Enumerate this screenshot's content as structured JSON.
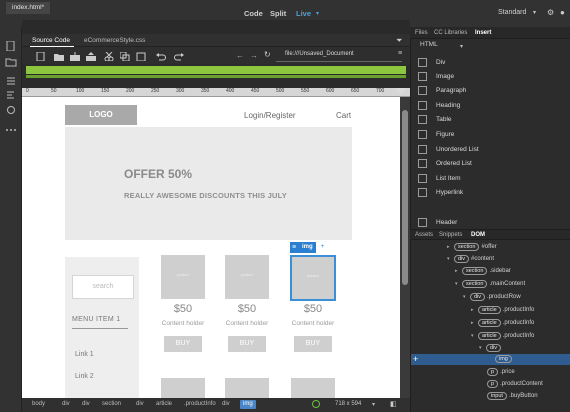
{
  "topbar": {
    "views": [
      "Code",
      "Split",
      "Live"
    ],
    "active_view": "Live",
    "workspace": "Standard",
    "workspace_icons": [
      "dropdown-icon",
      "gear-icon",
      "user-icon"
    ]
  },
  "document": {
    "tab": "index.html*",
    "subtabs": [
      "Source Code",
      "eCommerceStyle.css"
    ],
    "address": "file:///Unsaved_Document"
  },
  "ruler": {
    "ticks": [
      "0",
      "50",
      "100",
      "150",
      "200",
      "250",
      "300",
      "350",
      "400",
      "450",
      "500",
      "550",
      "600",
      "650",
      "700"
    ]
  },
  "page": {
    "logo": "LOGO",
    "nav": [
      "Login/Register",
      "Cart"
    ],
    "hero_title": "OFFER 50%",
    "hero_subtitle": "REALLY AWESOME DISCOUNTS THIS JULY",
    "search_placeholder": "search",
    "menu_title": "MENU ITEM 1",
    "links": [
      "Link 1",
      "Link 2"
    ],
    "products": [
      {
        "img_label": "product",
        "price": "$50",
        "holder": "Content holder",
        "buy": "BUY"
      },
      {
        "img_label": "product",
        "price": "$50",
        "holder": "Content holder",
        "buy": "BUY"
      },
      {
        "img_label": "product",
        "price": "$50",
        "holder": "Content holder",
        "buy": "BUY"
      }
    ],
    "selected_badge": "img",
    "selected_badge_plus": "+"
  },
  "status": {
    "crumbs": [
      "body",
      "div",
      "div",
      "section",
      "div",
      "article",
      ".productInfo",
      "div",
      "img"
    ],
    "active_crumb": "img",
    "size": "718 x 594"
  },
  "rightpanel": {
    "tabs": [
      "Files",
      "CC Libraries",
      "Insert"
    ],
    "active_tab": "Insert",
    "category": "HTML",
    "insert_items": [
      "Div",
      "Image",
      "Paragraph",
      "Heading",
      "Table",
      "Figure",
      "Unordered List",
      "Ordered List",
      "List Item",
      "Hyperlink",
      "Header"
    ],
    "bottom_tabs": [
      "Assets",
      "Snippets",
      "DOM"
    ],
    "active_bottom_tab": "DOM",
    "dom_rows": [
      {
        "tag": "section",
        "label": "#offer"
      },
      {
        "tag": "div",
        "label": "#content"
      },
      {
        "tag": "section",
        "label": ".sidebar"
      },
      {
        "tag": "section",
        "label": ".mainContent"
      },
      {
        "tag": "div",
        "label": ".productRow"
      },
      {
        "tag": "article",
        "label": ".productInfo"
      },
      {
        "tag": "article",
        "label": ".productInfo"
      },
      {
        "tag": "article",
        "label": ".productInfo"
      },
      {
        "tag": "div",
        "label": ""
      },
      {
        "tag": "img",
        "label": ""
      },
      {
        "tag": "p",
        "label": ".price"
      },
      {
        "tag": "p",
        "label": ".productContent"
      },
      {
        "tag": "input",
        "label": ".buyButton"
      }
    ]
  }
}
